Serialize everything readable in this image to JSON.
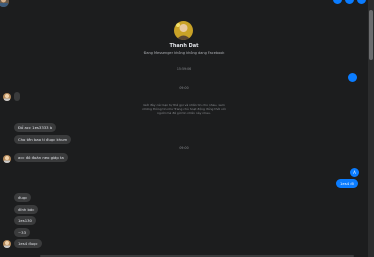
{
  "profile": {
    "name": "Thanh Dat",
    "subtitle": "Đang Messenger không không dang Facebook"
  },
  "timestamps": {
    "first": "15:59:06",
    "second": "09:00",
    "third": "09:00"
  },
  "system_note": "Giới đây các bạn tự thể gọi và nhắn tin cho nhau, xem những thông tin như Trang chủ hoạt động đồng thời với người mà để gửi tin nhắn này nhau.",
  "messages": {
    "top_right_dot": "",
    "received_a1": "",
    "received_b1": "Đổ acc 1es3333 à",
    "received_b2": "Cho tên bao ti đuọc khum",
    "received_b3": "acc đó đoàn neo giáp ta",
    "sent_1": "A",
    "sent_2": "1es4 đi",
    "received_c1": "đuọc",
    "received_c2": "đính bác",
    "received_c3": "1es130",
    "received_c4": "~33",
    "received_c5": "1es4 đuọc"
  },
  "colors": {
    "background": "#1c1d1e",
    "received_bubble": "#3a3b3c",
    "sent_bubble": "#0a7cff",
    "text": "#e4e6eb"
  }
}
